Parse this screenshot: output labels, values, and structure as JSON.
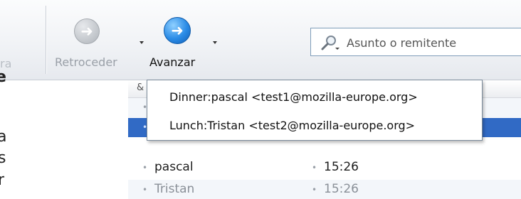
{
  "toolbar": {
    "partial_left_label": "ra",
    "back_label": "Retroceder",
    "forward_label": "Avanzar",
    "search_placeholder": "Asunto o remitente"
  },
  "left_cutoff_text": [
    "e",
    "a",
    "s",
    "r"
  ],
  "column_header_glyph": "&",
  "autocomplete": {
    "items": [
      "Dinner:pascal <test1@mozilla-europe.org>",
      "Lunch:Tristan <test2@mozilla-europe.org>"
    ]
  },
  "rows": [
    {
      "sender": "",
      "date": ""
    },
    {
      "sender": "",
      "date": ""
    },
    {
      "sender": "pascal",
      "date": "15:26"
    },
    {
      "sender": "Tristan",
      "date": "15:26"
    }
  ],
  "colors": {
    "selection": "#316ac5",
    "forward_icon": "#2a8be6"
  },
  "icons": [
    "back-arrow-icon",
    "forward-arrow-icon",
    "dropdown-arrow-icon",
    "magnifier-icon"
  ]
}
